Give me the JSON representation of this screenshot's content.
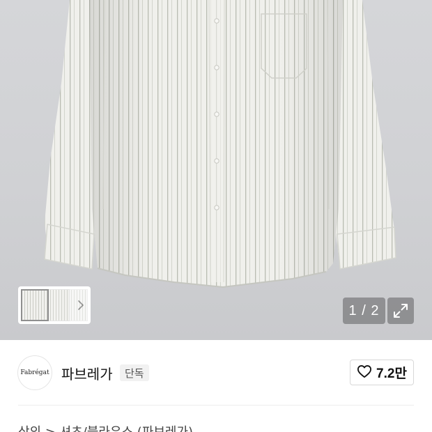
{
  "gallery": {
    "page_indicator": "1 / 2",
    "thumbnails": [
      "thumbnail-1",
      "thumbnail-2",
      "thumbnail-3"
    ],
    "next_icon": "chevron-right-icon",
    "expand_icon": "expand-arrows-icon"
  },
  "brand": {
    "logo_text": "Fabrégat",
    "name": "파브레가",
    "badge": "단독"
  },
  "like": {
    "icon": "heart-outline-icon",
    "count": "7.2만"
  },
  "breadcrumb": {
    "text": "상의 > 셔츠/블라우스 (파브레가)"
  },
  "colors": {
    "image_bg": "#d1d2d5",
    "overlay_button": "#78797c",
    "badge_bg": "#f1f1f1",
    "border": "#d8d8d8"
  }
}
